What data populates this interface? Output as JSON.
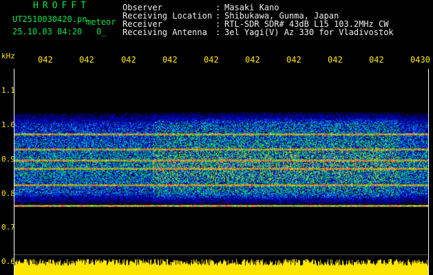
{
  "header": {
    "brand": "HROFFT",
    "filename": "UT2510030420.pn",
    "suffix": "meteor",
    "timestamp": "25.10.03 04:20",
    "counter": "0_"
  },
  "info": [
    {
      "label": "Observer",
      "value": "Masaki Kano"
    },
    {
      "label": "Receiving Location",
      "value": "Shibukawa, Gunma, Japan"
    },
    {
      "label": "Receiver",
      "value": "RTL-SDR SDR# 43dB L15 103.2MHz CW"
    },
    {
      "label": "Receiving Antenna",
      "value": "3el Yagi(V) Az 330 for Vladivostok"
    }
  ],
  "separator": ":",
  "axis": {
    "unit": "kHz",
    "time_ticks": [
      "042",
      "042",
      "042",
      "042",
      "042",
      "042",
      "042",
      "042",
      "042",
      "0430"
    ],
    "freq_ticks": [
      "1.1",
      "1.0",
      "0.9",
      "0.8",
      "0.7",
      "0.6"
    ]
  },
  "colors": {
    "text_green": "#00e84c",
    "text_white": "#f0f0f0",
    "text_yellow": "#ffe600",
    "signal_floor": "#ffe600",
    "echo_line": "#ff2e5a"
  }
}
